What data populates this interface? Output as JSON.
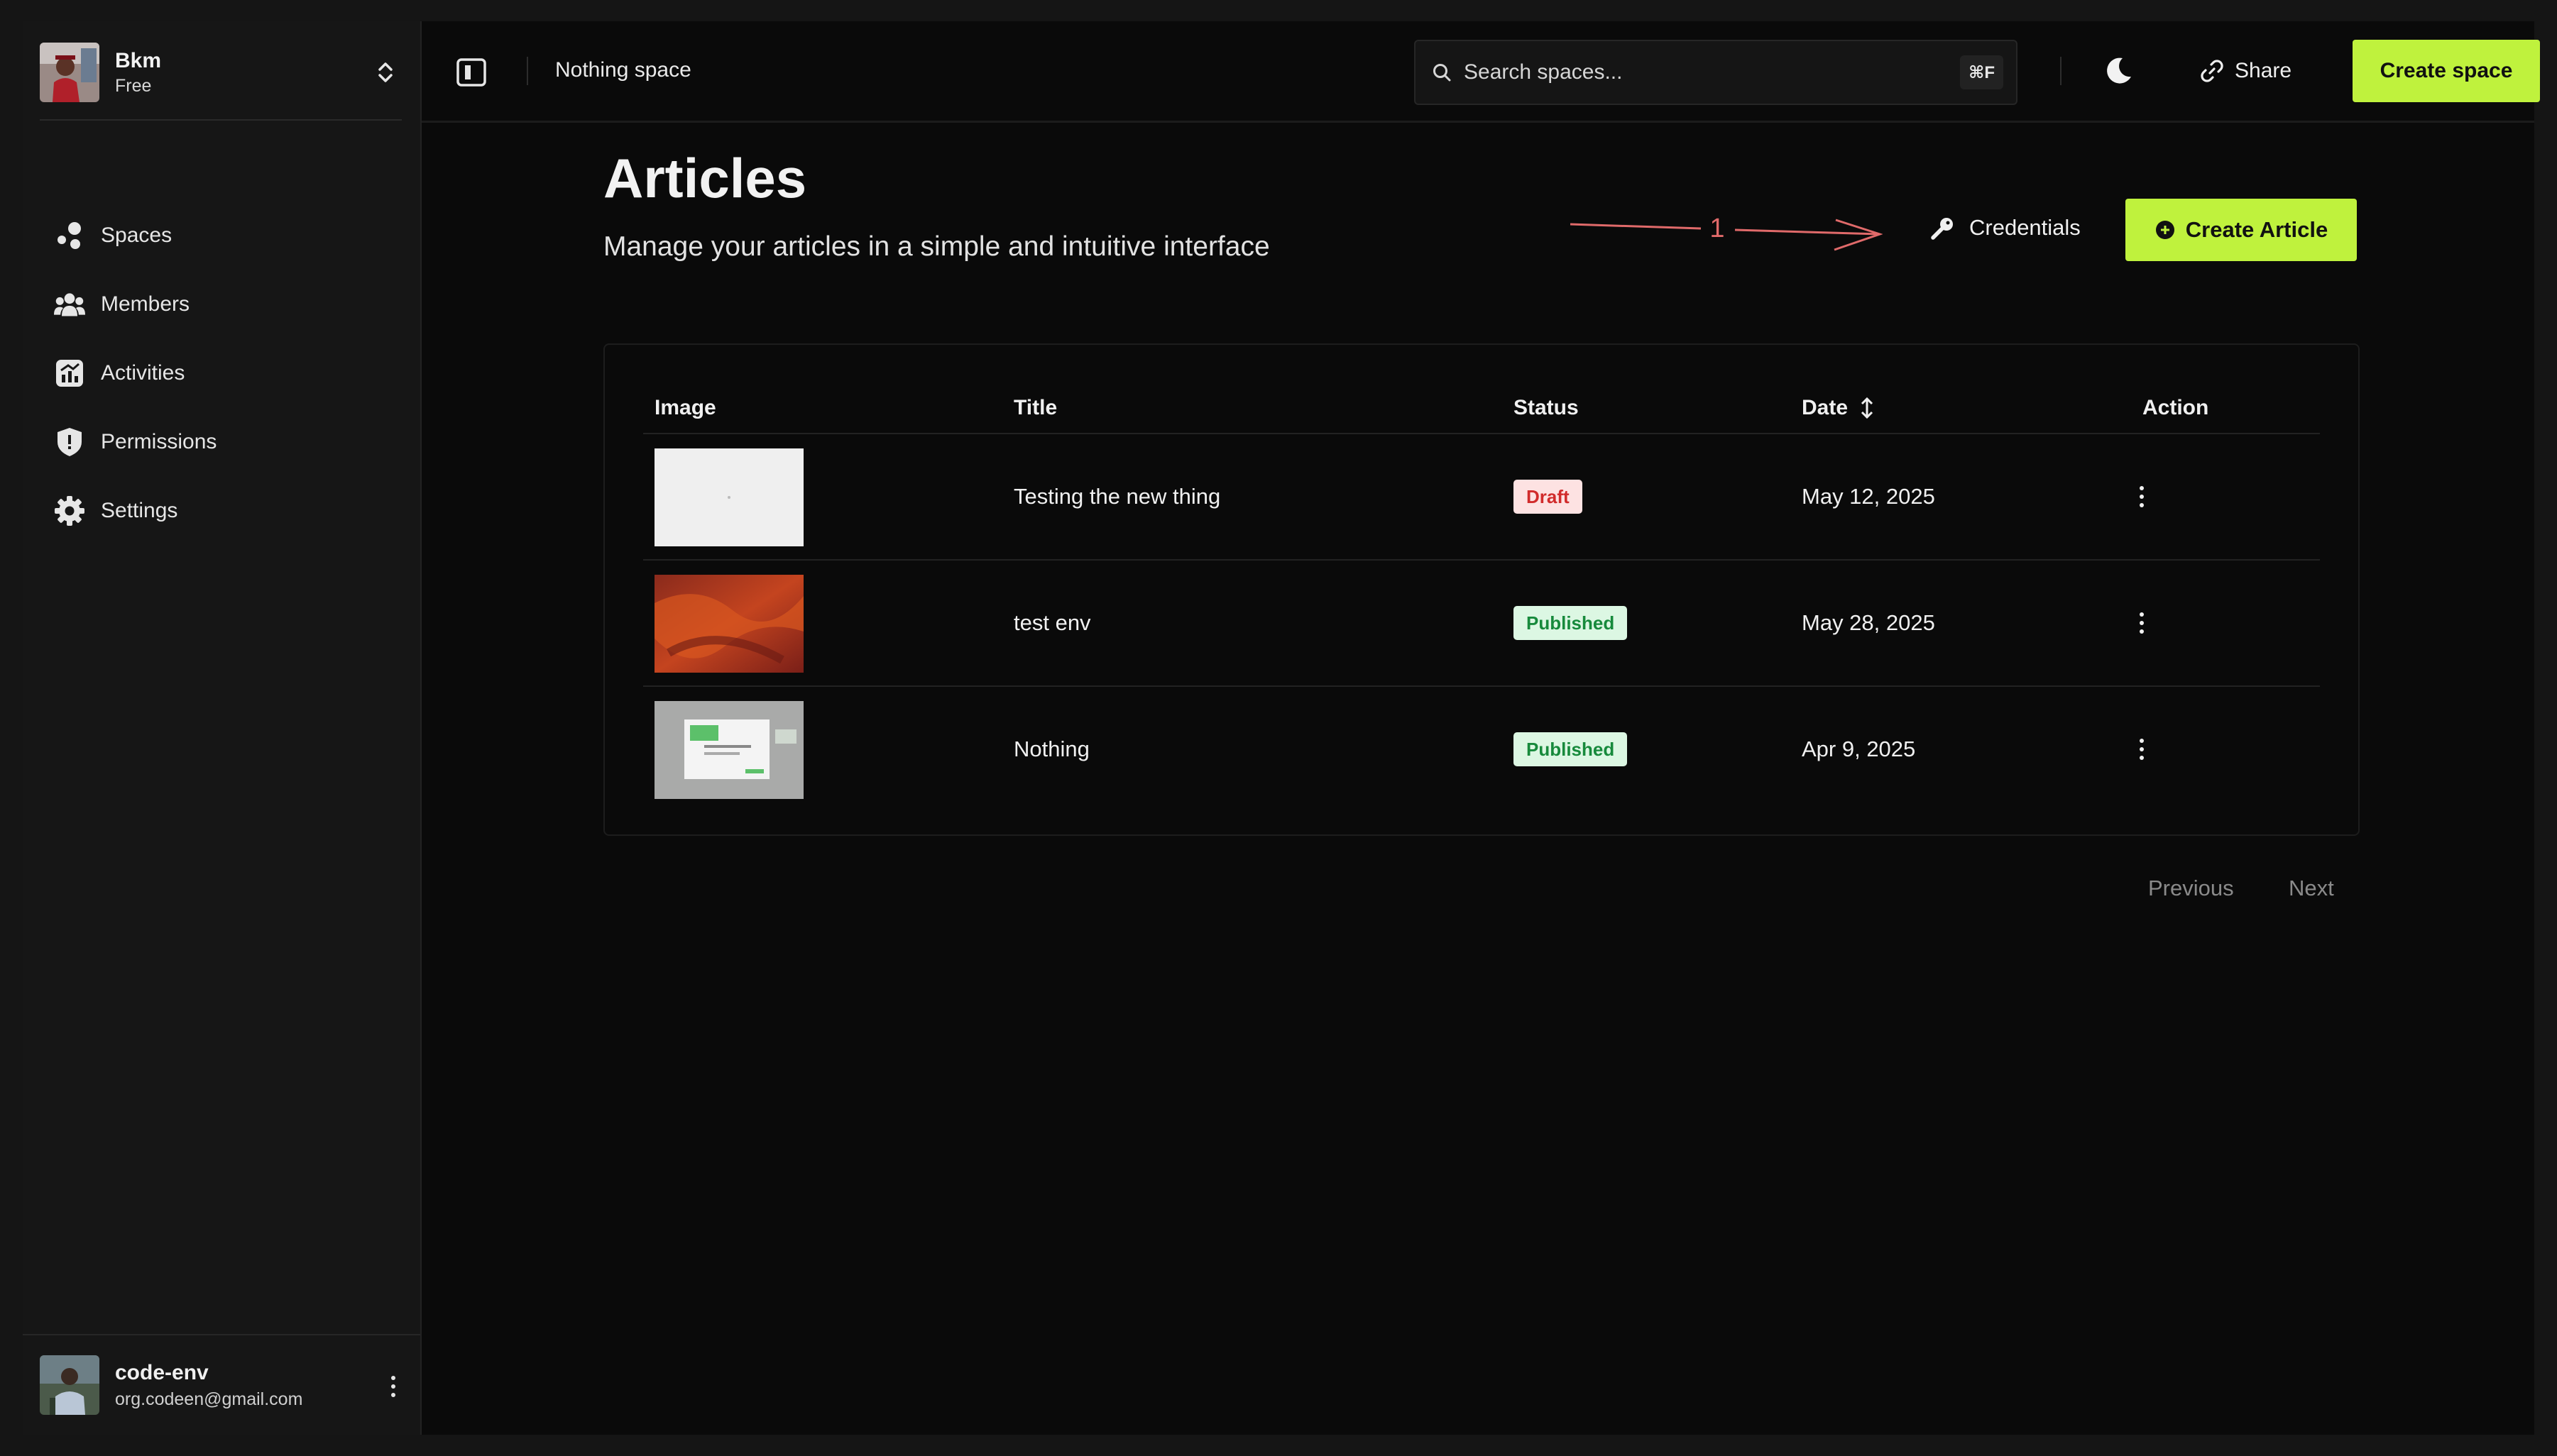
{
  "workspace": {
    "name": "Bkm",
    "plan": "Free"
  },
  "sidebar": {
    "items": [
      {
        "label": "Spaces",
        "icon": "spaces-icon"
      },
      {
        "label": "Members",
        "icon": "members-icon"
      },
      {
        "label": "Activities",
        "icon": "activities-icon"
      },
      {
        "label": "Permissions",
        "icon": "shield-icon"
      },
      {
        "label": "Settings",
        "icon": "gear-icon"
      }
    ]
  },
  "user": {
    "name": "code-env",
    "email": "org.codeen@gmail.com"
  },
  "topbar": {
    "breadcrumb": "Nothing space",
    "search_placeholder": "Search spaces...",
    "search_shortcut": "⌘F",
    "share_label": "Share",
    "create_space_label": "Create space"
  },
  "page": {
    "title": "Articles",
    "subtitle": "Manage your articles in a simple and intuitive interface",
    "annotation_label": "1",
    "credentials_label": "Credentials",
    "create_article_label": "Create Article"
  },
  "table": {
    "columns": {
      "image": "Image",
      "title": "Title",
      "status": "Status",
      "date": "Date",
      "action": "Action"
    },
    "rows": [
      {
        "title": "Testing the new thing",
        "status": "Draft",
        "date": "May 12, 2025"
      },
      {
        "title": "test env",
        "status": "Published",
        "date": "May 28, 2025"
      },
      {
        "title": "Nothing",
        "status": "Published",
        "date": "Apr 9, 2025"
      }
    ]
  },
  "pagination": {
    "previous": "Previous",
    "next": "Next"
  },
  "colors": {
    "accent": "#bff23d",
    "background": "#0a0a0a",
    "sidebar": "#161616",
    "draft_badge": "#fde2e2",
    "published_badge": "#dcf7e3",
    "annotation": "#e06a6a"
  }
}
